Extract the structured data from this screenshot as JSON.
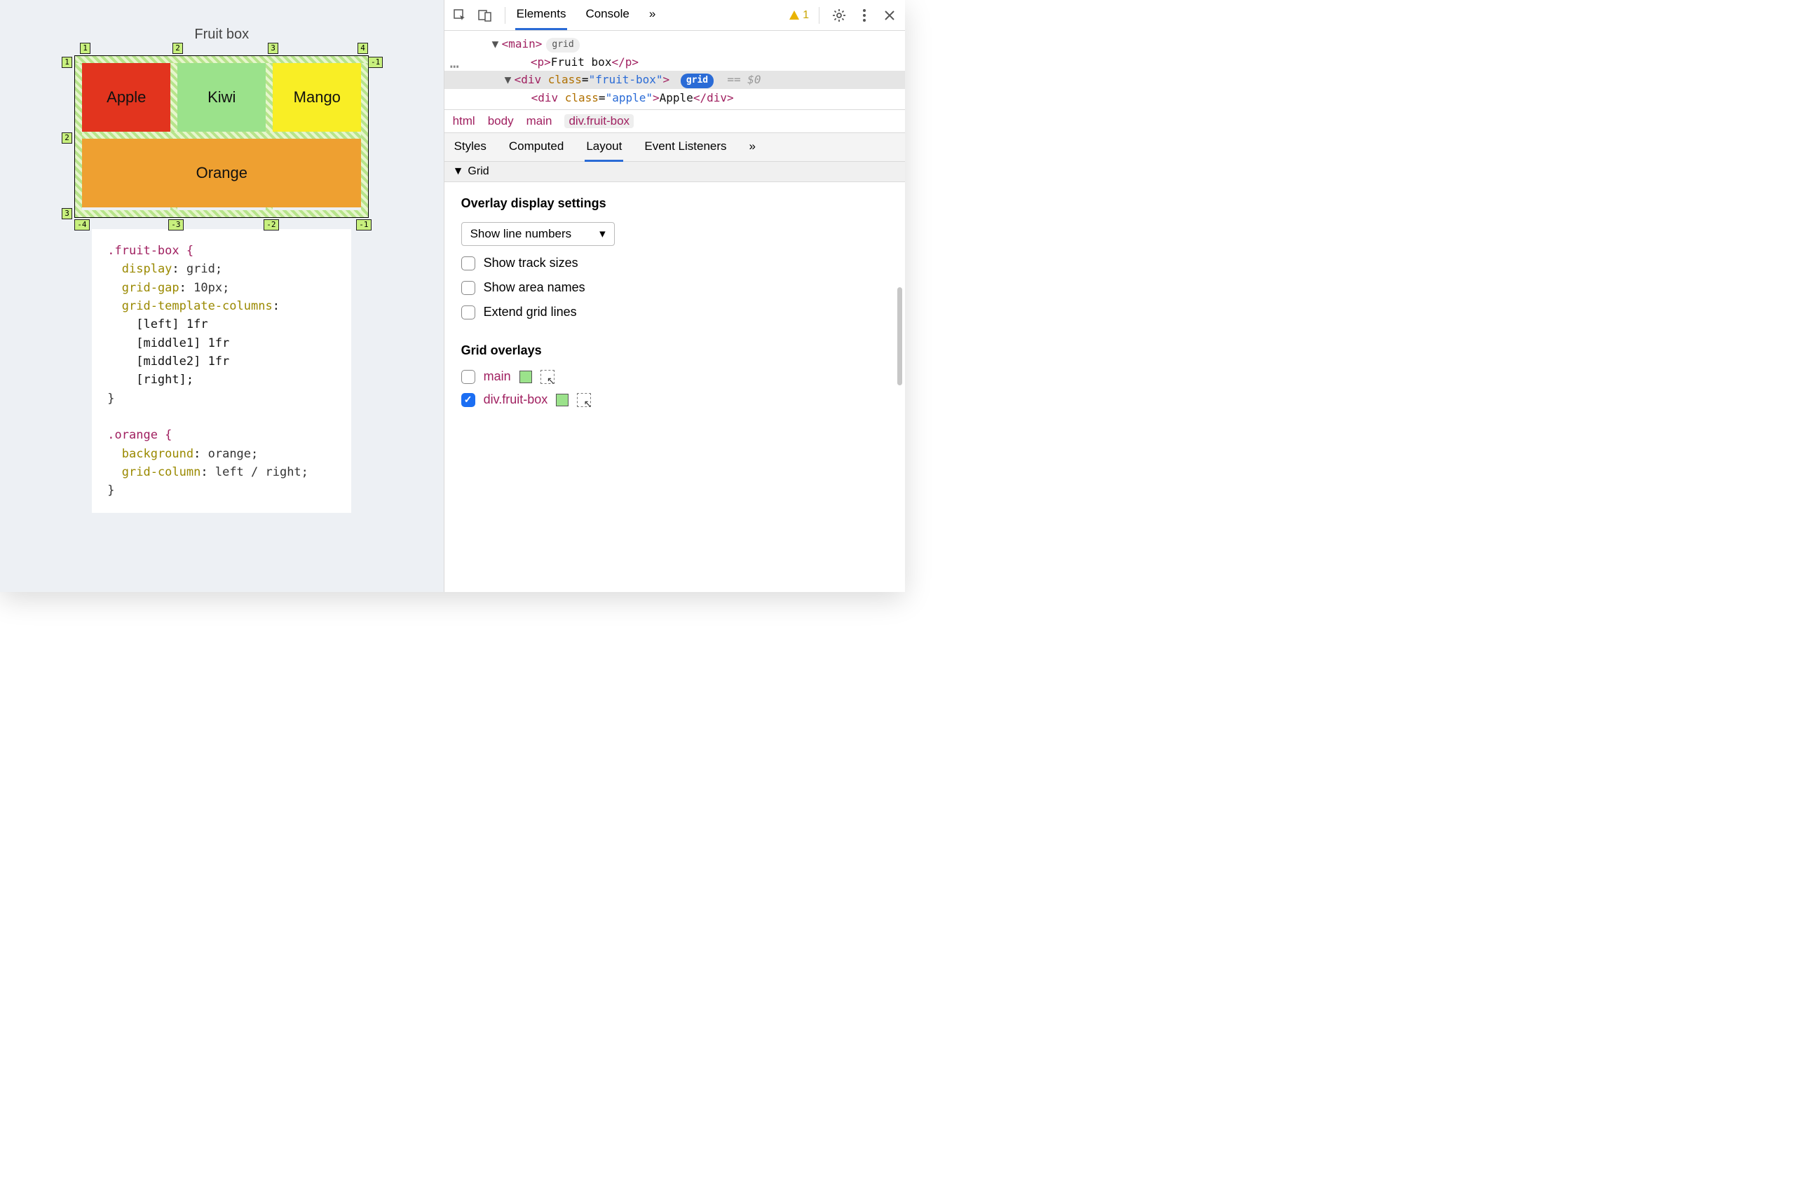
{
  "preview": {
    "title": "Fruit box",
    "cells": {
      "apple": "Apple",
      "kiwi": "Kiwi",
      "mango": "Mango",
      "orange": "Orange"
    },
    "line_numbers": {
      "top": [
        "1",
        "2",
        "3",
        "4"
      ],
      "left": [
        "1",
        "2",
        "3"
      ],
      "right": [
        "-1"
      ],
      "bottom": [
        "-4",
        "-3",
        "-2",
        "-1"
      ]
    },
    "css_snippet": {
      "rule1_selector": ".fruit-box {",
      "rule1_lines": [
        {
          "prop": "display",
          "val": "grid;"
        },
        {
          "prop": "grid-gap",
          "val": "10px;"
        },
        {
          "prop": "grid-template-columns",
          "val": ":"
        },
        {
          "raw": "    [left] 1fr"
        },
        {
          "raw": "    [middle1] 1fr"
        },
        {
          "raw": "    [middle2] 1fr"
        },
        {
          "raw": "    [right];"
        }
      ],
      "rule1_close": "}",
      "rule2_selector": ".orange {",
      "rule2_lines": [
        {
          "prop": "background",
          "val": "orange;"
        },
        {
          "prop": "grid-column",
          "val": "left / right;"
        }
      ],
      "rule2_close": "}"
    }
  },
  "devtools": {
    "tabs": {
      "elements": "Elements",
      "console": "Console"
    },
    "more": "»",
    "warn_count": "1",
    "dom": {
      "main_open": "<main>",
      "main_badge": "grid",
      "p_line": "<p>Fruit box</p>",
      "div_open_prefix": "<div ",
      "div_class_attr": "class",
      "div_class_val": "\"fruit-box\"",
      "div_open_suffix": ">",
      "div_badge": "grid",
      "selected_suffix": "== $0",
      "apple_line": "<div class=\"apple\">Apple</div>"
    },
    "breadcrumbs": [
      "html",
      "body",
      "main",
      "div.fruit-box"
    ],
    "subtabs": {
      "styles": "Styles",
      "computed": "Computed",
      "layout": "Layout",
      "event": "Event Listeners"
    },
    "grid_section": "Grid",
    "overlay_settings_heading": "Overlay display settings",
    "line_numbers_select": "Show line numbers",
    "checkboxes": {
      "track_sizes": "Show track sizes",
      "area_names": "Show area names",
      "extend_lines": "Extend grid lines"
    },
    "overlays_heading": "Grid overlays",
    "overlays": [
      {
        "checked": false,
        "name": "main",
        "swatch": "#9be28b"
      },
      {
        "checked": true,
        "name": "div.fruit-box",
        "swatch": "#9be28b"
      }
    ]
  }
}
